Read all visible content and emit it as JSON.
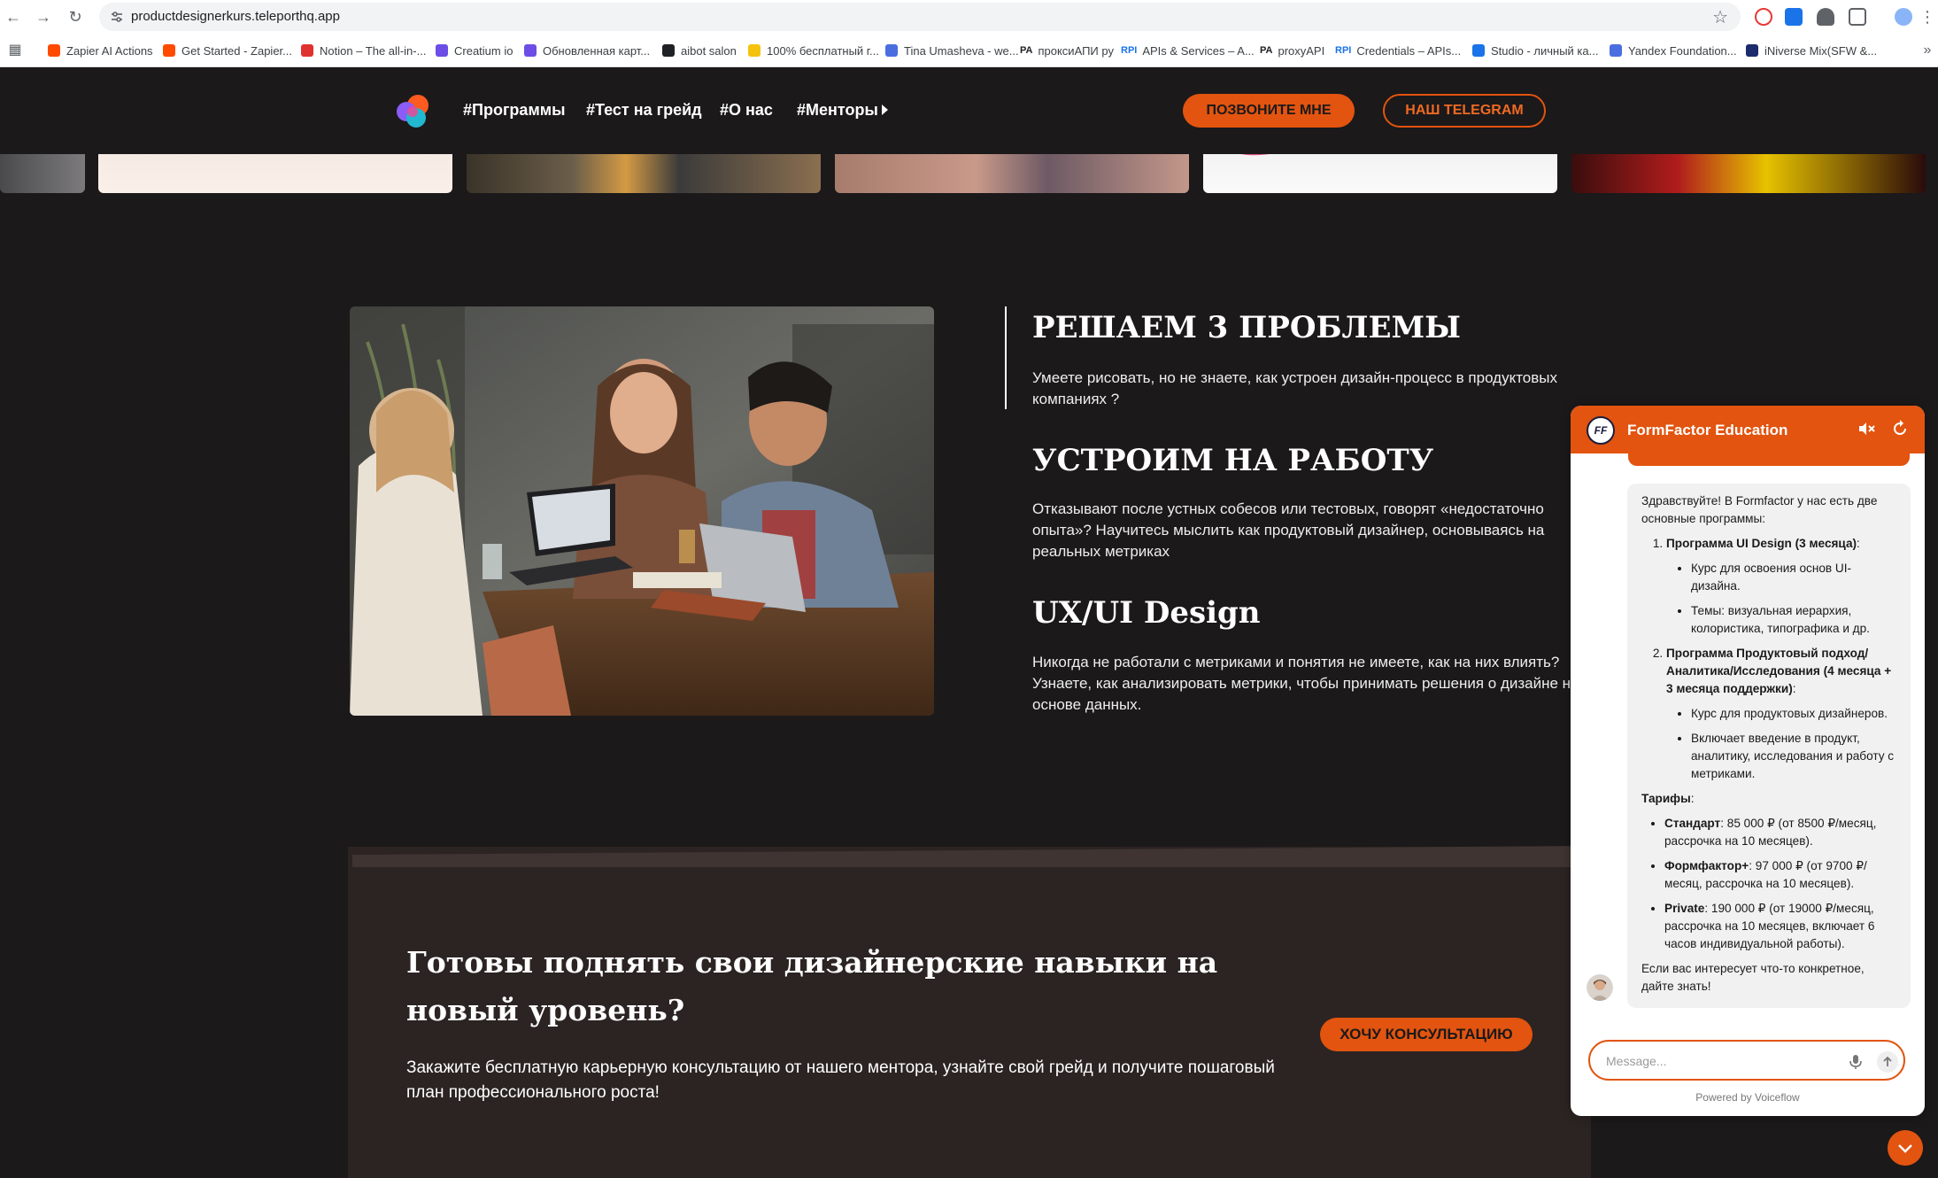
{
  "browser": {
    "url": "productdesignerkurs.teleporthq.app",
    "bookmarks": [
      {
        "label": "Zapier AI Actions",
        "color": "#ff4a00"
      },
      {
        "label": "Get Started - Zapier...",
        "color": "#ff4a00"
      },
      {
        "label": "Notion – The all-in-...",
        "color": "#e03131"
      },
      {
        "label": "Creatium io",
        "color": "#6c4de6"
      },
      {
        "label": "Обновленная карт...",
        "color": "#6c4de6"
      },
      {
        "label": "aibot salon",
        "color": "#202124"
      },
      {
        "label": "100% бесплатный г...",
        "color": "#f4c20d"
      },
      {
        "label": "Tina Umasheva - we...",
        "color": "#4a6ee0"
      },
      {
        "label": "проксиАПИ ру",
        "icon_text": "PA",
        "color": "#202124"
      },
      {
        "label": "APIs & Services – A...",
        "icon_text": "RPI",
        "color": "#1a73e8"
      },
      {
        "label": "proxyAPI",
        "icon_text": "PA",
        "color": "#202124"
      },
      {
        "label": "Credentials – APIs...",
        "icon_text": "RPI",
        "color": "#1a73e8"
      },
      {
        "label": "Studio - личный ка...",
        "color": "#1a73e8"
      },
      {
        "label": "Yandex Foundation...",
        "color": "#4a6ee0"
      },
      {
        "label": "iNiverse Mix(SFW &...",
        "color": "#1c2b6b"
      }
    ]
  },
  "header": {
    "menu": [
      "#Программы",
      "#Тест на грейд",
      "#О нас",
      "#Менторы"
    ],
    "call_button": "ПОЗВОНИТЕ МНЕ",
    "telegram_button": "НАШ TELEGRAM"
  },
  "problems": {
    "title_1": "РЕШАЕМ 3 ПРОБЛЕМЫ",
    "text_1": "Умеете рисовать, но не знаете, как устроен дизайн-процесс в продуктовых компаниях ?",
    "title_2": "УСТРОИМ НА РАБОТУ",
    "text_2": "Отказывают после устных собесов или тестовых, говорят «недостаточно опыта»? Научитесь мыслить как продуктовый дизайнер, основываясь на реальных метриках",
    "title_3": "UX/UI Design",
    "text_3": "Никогда не работали с метриками и понятия не имеете, как на них влиять? Узнаете, как анализировать метрики, чтобы принимать решения о дизайне на основе данных."
  },
  "cta": {
    "title": "Готовы поднять свои дизайнерские навыки на новый уровень?",
    "text": "Закажите бесплатную карьерную консультацию от нашего ментора, узнайте свой грейд и получите пошаговый план профессионального роста!",
    "button": "ХОЧУ КОНСУЛЬТАЦИЮ"
  },
  "chat": {
    "title": "FormFactor Education",
    "avatar_text": "FF",
    "intro": "Здравствуйте! В Formfactor у нас есть две основные программы:",
    "program_1_title": "Программа UI Design (3 месяца)",
    "program_1_bullets": [
      "Курс для освоения основ UI-дизайна.",
      "Темы: визуальная иерархия, колористика, типографика и др."
    ],
    "program_2_title": "Программа Продуктовый подход/Аналитика/Исследования (4 месяца + 3 месяца поддержки)",
    "program_2_bullets": [
      "Курс для продуктовых дизайнеров.",
      "Включает введение в продукт, аналитику, исследования и работу с метриками."
    ],
    "tariffs_label": "Тарифы",
    "tariffs": [
      {
        "name": "Стандарт",
        "details": ": 85 000 ₽ (от 8500 ₽/месяц, рассрочка на 10 месяцев)."
      },
      {
        "name": "Формфактор+",
        "details": ": 97 000 ₽ (от 9700 ₽/месяц, рассрочка на 10 месяцев)."
      },
      {
        "name": "Private",
        "details": ": 190 000 ₽ (от 19000 ₽/месяц, рассрочка на 10 месяцев, включает 6 часов индивидуальной работы)."
      }
    ],
    "outro": "Если вас интересует что-то конкретное, дайте знать!",
    "input_placeholder": "Message...",
    "powered_by": "Powered by Voiceflow"
  },
  "colors": {
    "accent": "#e2540f",
    "page_bg": "#1b191a",
    "card_bg": "#2b2422"
  }
}
